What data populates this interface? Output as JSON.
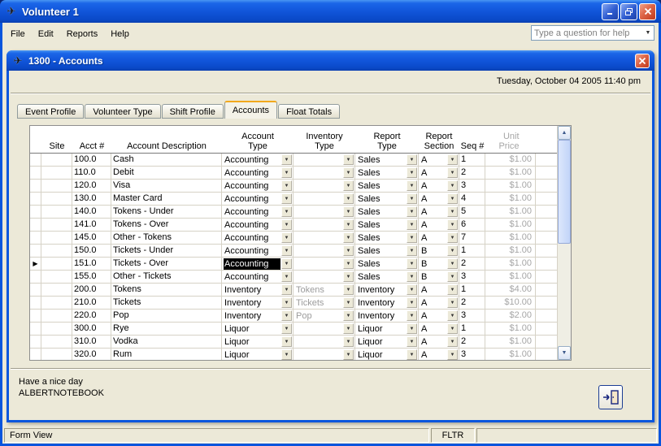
{
  "window": {
    "title": "Volunteer 1"
  },
  "menu": {
    "items": [
      "File",
      "Edit",
      "Reports",
      "Help"
    ],
    "help_placeholder": "Type a question for help"
  },
  "child": {
    "title": "1300 - Accounts",
    "datetime": "Tuesday, October 04 2005  11:40 pm",
    "status_line1": "Have a nice day",
    "status_line2": "ALBERTNOTEBOOK"
  },
  "tabs": [
    {
      "label": "Event Profile",
      "active": false
    },
    {
      "label": "Volunteer Type",
      "active": false
    },
    {
      "label": "Shift Profile",
      "active": false
    },
    {
      "label": "Accounts",
      "active": true
    },
    {
      "label": "Float Totals",
      "active": false
    }
  ],
  "table": {
    "headers": {
      "site": "Site",
      "acct": "Acct #",
      "desc": "Account Description",
      "account_type": "Account\nType",
      "inventory_type": "Inventory\nType",
      "report_type": "Report\nType",
      "report_section": "Report\nSection",
      "seq": "Seq #",
      "unit_price": "Unit\nPrice"
    },
    "rows": [
      {
        "site": "",
        "acct": "100.0",
        "desc": "Cash",
        "account_type": "Accounting",
        "inventory_type": "",
        "report_type": "Sales",
        "report_section": "A",
        "seq": "1",
        "unit_price": "$1.00",
        "selected": false
      },
      {
        "site": "",
        "acct": "110.0",
        "desc": "Debit",
        "account_type": "Accounting",
        "inventory_type": "",
        "report_type": "Sales",
        "report_section": "A",
        "seq": "2",
        "unit_price": "$1.00",
        "selected": false
      },
      {
        "site": "",
        "acct": "120.0",
        "desc": "Visa",
        "account_type": "Accounting",
        "inventory_type": "",
        "report_type": "Sales",
        "report_section": "A",
        "seq": "3",
        "unit_price": "$1.00",
        "selected": false
      },
      {
        "site": "",
        "acct": "130.0",
        "desc": "Master Card",
        "account_type": "Accounting",
        "inventory_type": "",
        "report_type": "Sales",
        "report_section": "A",
        "seq": "4",
        "unit_price": "$1.00",
        "selected": false
      },
      {
        "site": "",
        "acct": "140.0",
        "desc": "Tokens - Under",
        "account_type": "Accounting",
        "inventory_type": "",
        "report_type": "Sales",
        "report_section": "A",
        "seq": "5",
        "unit_price": "$1.00",
        "selected": false
      },
      {
        "site": "",
        "acct": "141.0",
        "desc": "Tokens - Over",
        "account_type": "Accounting",
        "inventory_type": "",
        "report_type": "Sales",
        "report_section": "A",
        "seq": "6",
        "unit_price": "$1.00",
        "selected": false
      },
      {
        "site": "",
        "acct": "145.0",
        "desc": "Other - Tokens",
        "account_type": "Accounting",
        "inventory_type": "",
        "report_type": "Sales",
        "report_section": "A",
        "seq": "7",
        "unit_price": "$1.00",
        "selected": false
      },
      {
        "site": "",
        "acct": "150.0",
        "desc": "Tickets - Under",
        "account_type": "Accounting",
        "inventory_type": "",
        "report_type": "Sales",
        "report_section": "B",
        "seq": "1",
        "unit_price": "$1.00",
        "selected": false
      },
      {
        "site": "",
        "acct": "151.0",
        "desc": "Tickets - Over",
        "account_type": "Accounting",
        "inventory_type": "",
        "report_type": "Sales",
        "report_section": "B",
        "seq": "2",
        "unit_price": "$1.00",
        "selected": true
      },
      {
        "site": "",
        "acct": "155.0",
        "desc": "Other - Tickets",
        "account_type": "Accounting",
        "inventory_type": "",
        "report_type": "Sales",
        "report_section": "B",
        "seq": "3",
        "unit_price": "$1.00",
        "selected": false
      },
      {
        "site": "",
        "acct": "200.0",
        "desc": "Tokens",
        "account_type": "Inventory",
        "inventory_type": "Tokens",
        "report_type": "Inventory",
        "report_section": "A",
        "seq": "1",
        "unit_price": "$4.00",
        "selected": false
      },
      {
        "site": "",
        "acct": "210.0",
        "desc": "Tickets",
        "account_type": "Inventory",
        "inventory_type": "Tickets",
        "report_type": "Inventory",
        "report_section": "A",
        "seq": "2",
        "unit_price": "$10.00",
        "selected": false
      },
      {
        "site": "",
        "acct": "220.0",
        "desc": "Pop",
        "account_type": "Inventory",
        "inventory_type": "Pop",
        "report_type": "Inventory",
        "report_section": "A",
        "seq": "3",
        "unit_price": "$2.00",
        "selected": false
      },
      {
        "site": "",
        "acct": "300.0",
        "desc": "Rye",
        "account_type": "Liquor",
        "inventory_type": "",
        "report_type": "Liquor",
        "report_section": "A",
        "seq": "1",
        "unit_price": "$1.00",
        "selected": false
      },
      {
        "site": "",
        "acct": "310.0",
        "desc": "Vodka",
        "account_type": "Liquor",
        "inventory_type": "",
        "report_type": "Liquor",
        "report_section": "A",
        "seq": "2",
        "unit_price": "$1.00",
        "selected": false
      },
      {
        "site": "",
        "acct": "320.0",
        "desc": "Rum",
        "account_type": "Liquor",
        "inventory_type": "",
        "report_type": "Liquor",
        "report_section": "A",
        "seq": "3",
        "unit_price": "$1.00",
        "selected": false
      }
    ]
  },
  "statusbar": {
    "left": "Form View",
    "filter": "FLTR"
  },
  "colors": {
    "titlebar_blue": "#1257DC",
    "close_red": "#C03A1D",
    "window_face": "#ECE9D8",
    "selection": "#000000",
    "active_tab_accent": "#F2A81D"
  }
}
